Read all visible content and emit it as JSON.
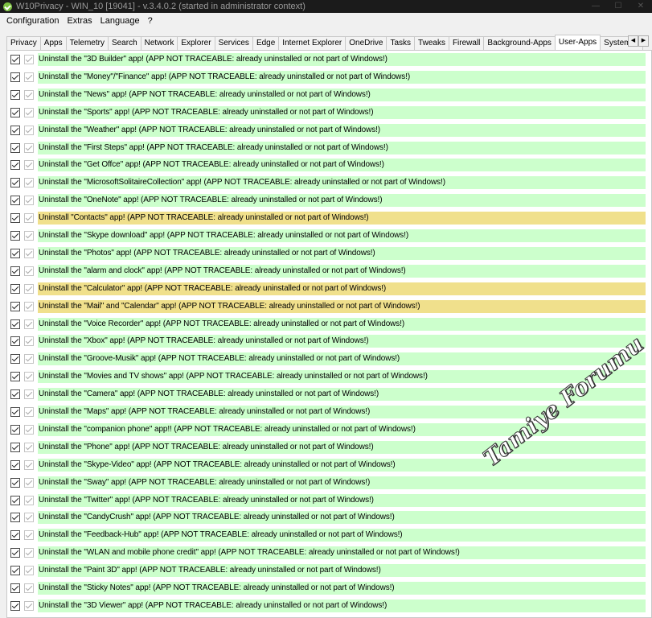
{
  "window": {
    "title": "W10Privacy - WIN_10 [19041]  - v.3.4.0.2 (started in administrator context)",
    "minimize_glyph": "—",
    "maximize_glyph": "☐",
    "close_glyph": "✕"
  },
  "menu": [
    "Configuration",
    "Extras",
    "Language",
    "?"
  ],
  "tabs": [
    "Privacy",
    "Apps",
    "Telemetry",
    "Search",
    "Network",
    "Explorer",
    "Services",
    "Edge",
    "Internet Explorer",
    "OneDrive",
    "Tasks",
    "Tweaks",
    "Firewall",
    "Background-Apps",
    "User-Apps",
    "System-A"
  ],
  "active_tab": "User-Apps",
  "tab_scroll": {
    "left": "◀",
    "right": "▶"
  },
  "colors": {
    "green": "#ccffcc",
    "yellow": "#f0e08c"
  },
  "items": [
    {
      "text": "Uninstall the \"3D Builder\" app! (APP NOT TRACEABLE: already uninstalled or not part of Windows!)",
      "color": "green"
    },
    {
      "text": "Uninstall the \"Money\"/\"Finance\" app! (APP NOT TRACEABLE: already uninstalled or not part of Windows!)",
      "color": "green"
    },
    {
      "text": "Uninstall the \"News\" app! (APP NOT TRACEABLE: already uninstalled or not part of Windows!)",
      "color": "green"
    },
    {
      "text": "Uninstall the \"Sports\" app! (APP NOT TRACEABLE: already uninstalled or not part of Windows!)",
      "color": "green"
    },
    {
      "text": "Uninstall the \"Weather\" app! (APP NOT TRACEABLE: already uninstalled or not part of Windows!)",
      "color": "green"
    },
    {
      "text": "Uninstall the \"First Steps\" app! (APP NOT TRACEABLE: already uninstalled or not part of Windows!)",
      "color": "green"
    },
    {
      "text": "Uninstall the \"Get Offce\" app! (APP NOT TRACEABLE: already uninstalled or not part of Windows!)",
      "color": "green"
    },
    {
      "text": "Uninstall the \"MicrosoftSolitaireCollection\" app! (APP NOT TRACEABLE: already uninstalled or not part of Windows!)",
      "color": "green"
    },
    {
      "text": "Uninstall the \"OneNote\" app! (APP NOT TRACEABLE: already uninstalled or not part of Windows!)",
      "color": "green"
    },
    {
      "text": "Uninstall \"Contacts\" app! (APP NOT TRACEABLE: already uninstalled or not part of Windows!)",
      "color": "yellow"
    },
    {
      "text": "Uninstall the \"Skype download\" app! (APP NOT TRACEABLE: already uninstalled or not part of Windows!)",
      "color": "green"
    },
    {
      "text": "Uninstall the \"Photos\" app! (APP NOT TRACEABLE: already uninstalled or not part of Windows!)",
      "color": "green"
    },
    {
      "text": "Uninstall the \"alarm and clock\" app! (APP NOT TRACEABLE: already uninstalled or not part of Windows!)",
      "color": "green"
    },
    {
      "text": "Uninstall the \"Calculator\" app! (APP NOT TRACEABLE: already uninstalled or not part of Windows!)",
      "color": "yellow"
    },
    {
      "text": "Uninstall the \"Mail\" and \"Calendar\" app! (APP NOT TRACEABLE: already uninstalled or not part of Windows!)",
      "color": "yellow"
    },
    {
      "text": "Uninstall the \"Voice Recorder\" app! (APP NOT TRACEABLE: already uninstalled or not part of Windows!)",
      "color": "green"
    },
    {
      "text": "Uninstall the \"Xbox\" app! (APP NOT TRACEABLE: already uninstalled or not part of Windows!)",
      "color": "green"
    },
    {
      "text": "Uninstall the \"Groove-Musik\" app! (APP NOT TRACEABLE: already uninstalled or not part of Windows!)",
      "color": "green"
    },
    {
      "text": "Uninstall the \"Movies and TV shows\" app! (APP NOT TRACEABLE: already uninstalled or not part of Windows!)",
      "color": "green"
    },
    {
      "text": "Uninstall the \"Camera\" app! (APP NOT TRACEABLE: already uninstalled or not part of Windows!)",
      "color": "green"
    },
    {
      "text": "Uninstall the \"Maps\" app! (APP NOT TRACEABLE: already uninstalled or not part of Windows!)",
      "color": "green"
    },
    {
      "text": "Uninstall the \"companion phone\" app!! (APP NOT TRACEABLE: already uninstalled or not part of Windows!)",
      "color": "green"
    },
    {
      "text": "Uninstall the \"Phone\" app! (APP NOT TRACEABLE: already uninstalled or not part of Windows!)",
      "color": "green"
    },
    {
      "text": "Uninstall the \"Skype-Video\" app! (APP NOT TRACEABLE: already uninstalled or not part of Windows!)",
      "color": "green"
    },
    {
      "text": "Uninstall the \"Sway\" app! (APP NOT TRACEABLE: already uninstalled or not part of Windows!)",
      "color": "green"
    },
    {
      "text": "Uninstall the \"Twitter\" app! (APP NOT TRACEABLE: already uninstalled or not part of Windows!)",
      "color": "green"
    },
    {
      "text": "Uninstall the \"CandyCrush\" app! (APP NOT TRACEABLE: already uninstalled or not part of Windows!)",
      "color": "green"
    },
    {
      "text": "Uninstall the \"Feedback-Hub\" app! (APP NOT TRACEABLE: already uninstalled or not part of Windows!)",
      "color": "green"
    },
    {
      "text": "Uninstall the \"WLAN and mobile phone credit\" app! (APP NOT TRACEABLE: already uninstalled or not part of Windows!)",
      "color": "green"
    },
    {
      "text": "Uninstall the \"Paint 3D\" app! (APP NOT TRACEABLE: already uninstalled or not part of Windows!)",
      "color": "green"
    },
    {
      "text": "Uninstall the \"Sticky Notes\" app! (APP NOT TRACEABLE: already uninstalled or not part of Windows!)",
      "color": "green"
    },
    {
      "text": "Uninstall the \"3D Viewer\" app! (APP NOT TRACEABLE: already uninstalled or not part of Windows!)",
      "color": "green"
    }
  ],
  "watermark": "Tamiye Forumu"
}
